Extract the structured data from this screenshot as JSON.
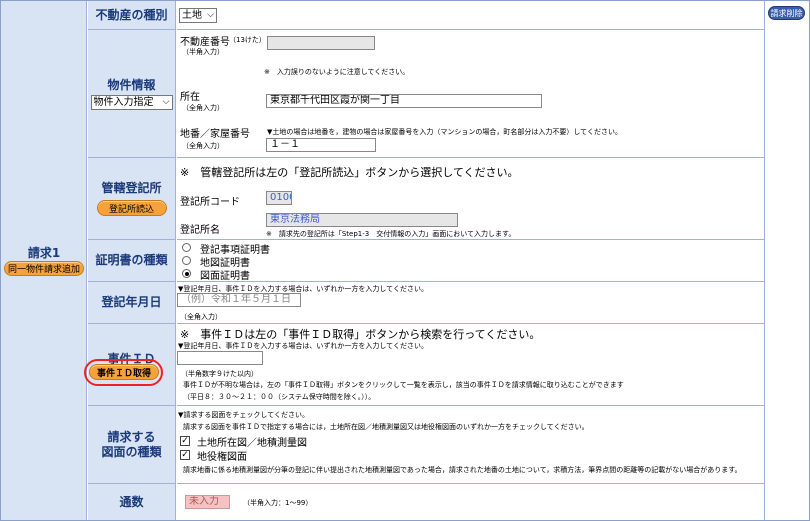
{
  "request": {
    "title": "請求1",
    "duplicate_button": "同一物件請求追加",
    "delete_button": "請求削除"
  },
  "property_type": {
    "label": "不動産の種別",
    "selected": "土地"
  },
  "property_info": {
    "label": "物件情報",
    "input_method": "物件入力指定",
    "realty_no_label": "不動産番号",
    "realty_no_digits": "（13けた）",
    "realty_no_hint": "（半角入力）",
    "realty_no_value": "",
    "realty_no_note": "※　入力誤りのないように注意してください。",
    "location_label": "所在",
    "location_hint": "（全角入力）",
    "location_value": "東京都千代田区霞が関一丁目",
    "lot_label": "地番／家屋番号",
    "lot_note": "▼土地の場合は地番を，建物の場合は家屋番号を入力（マンションの場合，町名部分は入力不要）してください。",
    "lot_hint": "（全角入力）",
    "lot_value": "１－１"
  },
  "registry": {
    "label": "管轄登記所",
    "read_button": "登記所読込",
    "note": "※　管轄登記所は左の「登記所読込」ボタンから選択してください。",
    "code_label": "登記所コード",
    "code_value": "0100",
    "name_label": "登記所名",
    "name_value": "東京法務局",
    "name_note": "※　請求先の登記所は「Step1-3　交付情報の入力」画面において入力します。"
  },
  "certificate": {
    "label": "証明書の種類",
    "options": [
      "登記事項証明書",
      "地図証明書",
      "図面証明書"
    ],
    "selected_index": 2
  },
  "registration_date": {
    "label": "登記年月日",
    "note": "▼登記年月日、事件ＩＤを入力する場合は、いずれか一方を入力してください。",
    "placeholder": "（例）令和１年５月１日",
    "hint": "（全角入力）"
  },
  "case_id": {
    "label": "事件ＩＤ",
    "button": "事件ＩＤ取得",
    "note": "※　事件ＩＤは左の「事件ＩＤ取得」ボタンから検索を行ってください。",
    "sub_note": "▼登記年月日、事件ＩＤを入力する場合は、いずれか一方を入力してください。",
    "value": "",
    "hint": "（半角数字９けた以内）",
    "info1": "事件ＩＤが不明な場合は，左の「事件ＩＤ取得」ボタンをクリックして一覧を表示し，該当の事件ＩＤを請求情報に取り込むことができます",
    "info2": "（平日８：３０～２１：００（システム保守時間を除く。））。"
  },
  "drawings": {
    "label_line1": "請求する",
    "label_line2": "図面の種類",
    "note1": "▼請求する図面をチェックしてください。",
    "note2": "請求する図面を事件ＩＤで指定する場合には，土地所在図／地積測量図又は地役権図面のいずれか一方をチェックしてください。",
    "options": [
      {
        "label": "土地所在図／地積測量図",
        "checked": true
      },
      {
        "label": "地役権図面",
        "checked": true
      }
    ],
    "footer": "請求地番に係る地積測量図が分筆の登記に伴い提出された地積測量図であった場合，請求された地番の土地について，求積方法，筆界点間の距離等の記載がない場合があります。"
  },
  "copies": {
    "label": "通数",
    "placeholder": "未入力",
    "hint": "（半角入力：1～99）"
  }
}
